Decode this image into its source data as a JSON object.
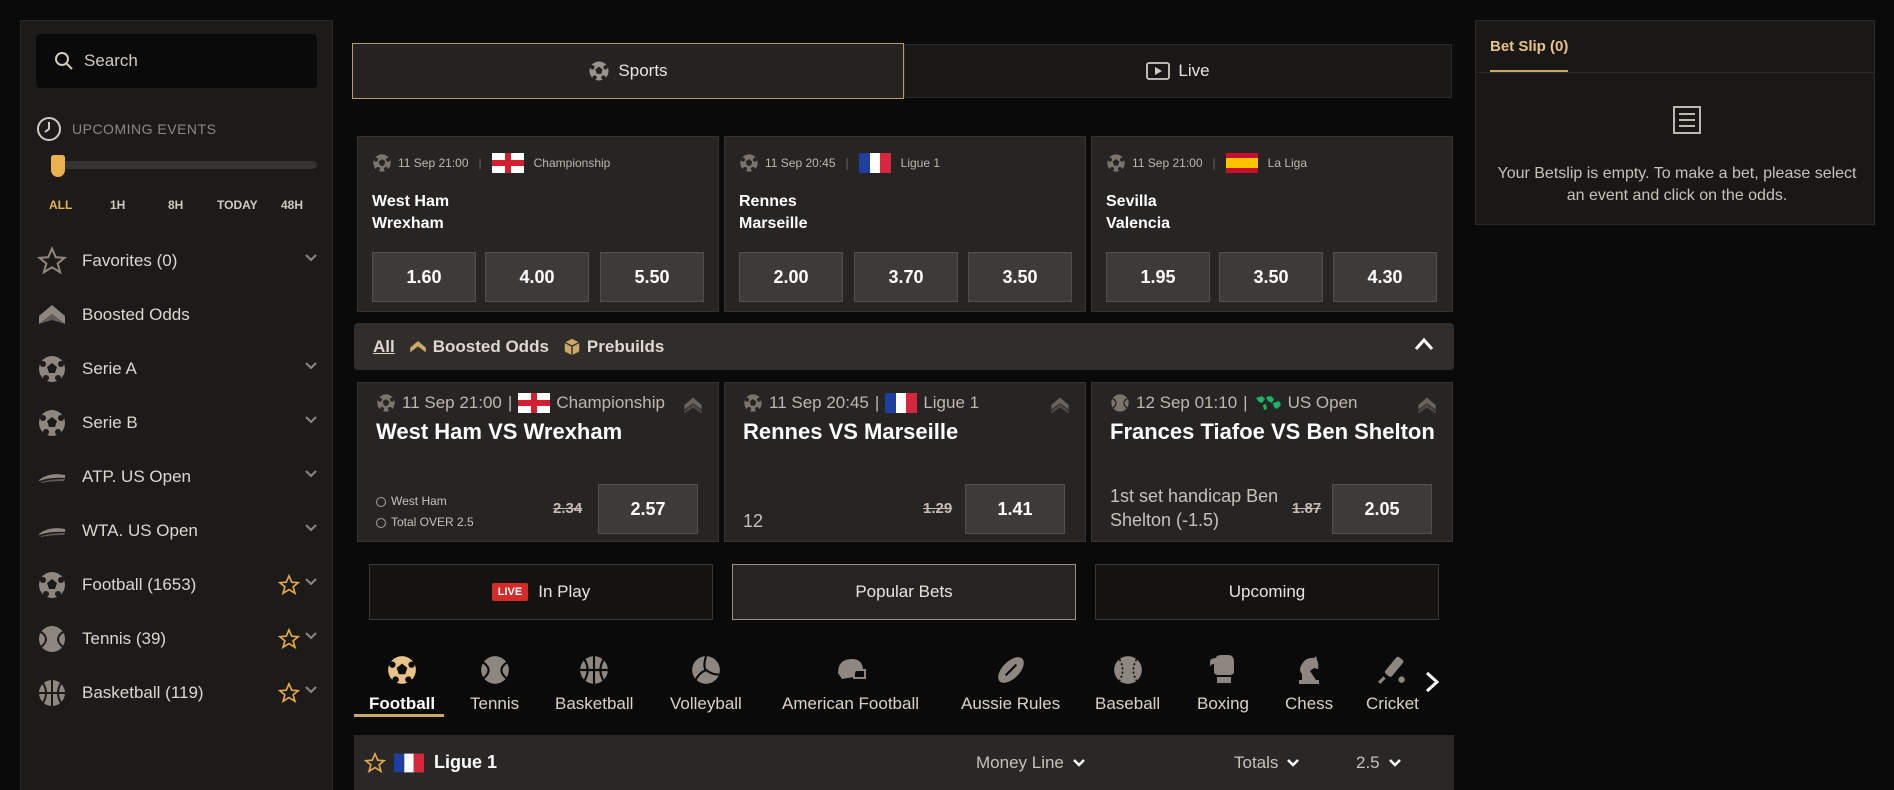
{
  "sidebar": {
    "search_placeholder": "Search",
    "upcoming_label": "UPCOMING EVENTS",
    "time_filters": [
      "ALL",
      "1H",
      "8H",
      "TODAY",
      "48H"
    ],
    "items": [
      {
        "label": "Favorites (0)",
        "icon": "star-outline-icon"
      },
      {
        "label": "Boosted Odds",
        "icon": "boost-icon"
      },
      {
        "label": "Serie A",
        "icon": "soccer-ball-icon"
      },
      {
        "label": "Serie B",
        "icon": "soccer-ball-icon"
      },
      {
        "label": "ATP. US Open",
        "icon": "tennis-shoe-icon"
      },
      {
        "label": "WTA. US Open",
        "icon": "tennis-shoe-icon"
      },
      {
        "label": "Football (1653)",
        "icon": "soccer-ball-icon"
      },
      {
        "label": "Tennis (39)",
        "icon": "tennis-ball-icon"
      },
      {
        "label": "Basketball (119)",
        "icon": "basketball-icon"
      }
    ]
  },
  "tabs": {
    "sports": "Sports",
    "live": "Live"
  },
  "match_cards": [
    {
      "datetime": "11 Sep 21:00",
      "league": "Championship",
      "home": "West Ham",
      "away": "Wrexham",
      "odds": [
        "1.60",
        "4.00",
        "5.50"
      ]
    },
    {
      "datetime": "11 Sep 20:45",
      "league": "Ligue 1",
      "home": "Rennes",
      "away": "Marseille",
      "odds": [
        "2.00",
        "3.70",
        "3.50"
      ]
    },
    {
      "datetime": "11 Sep 21:00",
      "league": "La Liga",
      "home": "Sevilla",
      "away": "Valencia",
      "odds": [
        "1.95",
        "3.50",
        "4.30"
      ]
    }
  ],
  "filters": {
    "all": "All",
    "boosted": "Boosted Odds",
    "prebuilds": "Prebuilds"
  },
  "boosted_cards": [
    {
      "datetime": "11 Sep 21:00",
      "league": "Championship",
      "title": "West Ham VS Wrexham",
      "selection_1": "West Ham",
      "selection_2": "Total OVER 2.5",
      "old_odd": "2.34",
      "new_odd": "2.57"
    },
    {
      "datetime": "11 Sep 20:45",
      "league": "Ligue 1",
      "title": "Rennes VS Marseille",
      "desc": "12",
      "old_odd": "1.29",
      "new_odd": "1.41"
    },
    {
      "datetime": "12 Sep 01:10",
      "league": "US Open",
      "title": "Frances Tiafoe VS Ben Shelton",
      "desc_1": "1st set handicap Ben",
      "desc_2": "Shelton (-1.5)",
      "old_odd": "1.87",
      "new_odd": "2.05"
    }
  ],
  "bottom_tabs": {
    "live_badge": "LIVE",
    "in_play": "In Play",
    "popular": "Popular Bets",
    "upcoming": "Upcoming"
  },
  "sports": [
    "Football",
    "Tennis",
    "Basketball",
    "Volleyball",
    "American Football",
    "Aussie Rules",
    "Baseball",
    "Boxing",
    "Chess",
    "Cricket"
  ],
  "league_row": {
    "name": "Ligue 1",
    "markets": [
      "Money Line",
      "Totals",
      "2.5"
    ]
  },
  "betslip": {
    "tab": "Bet Slip (0)",
    "message": "Your Betslip is empty. To make a bet, please select an event and click on the odds."
  },
  "colors": {
    "accent": "#c9a86a",
    "handle": "#e8b24f",
    "live": "#d32a2a",
    "star": "#e2a84a"
  }
}
